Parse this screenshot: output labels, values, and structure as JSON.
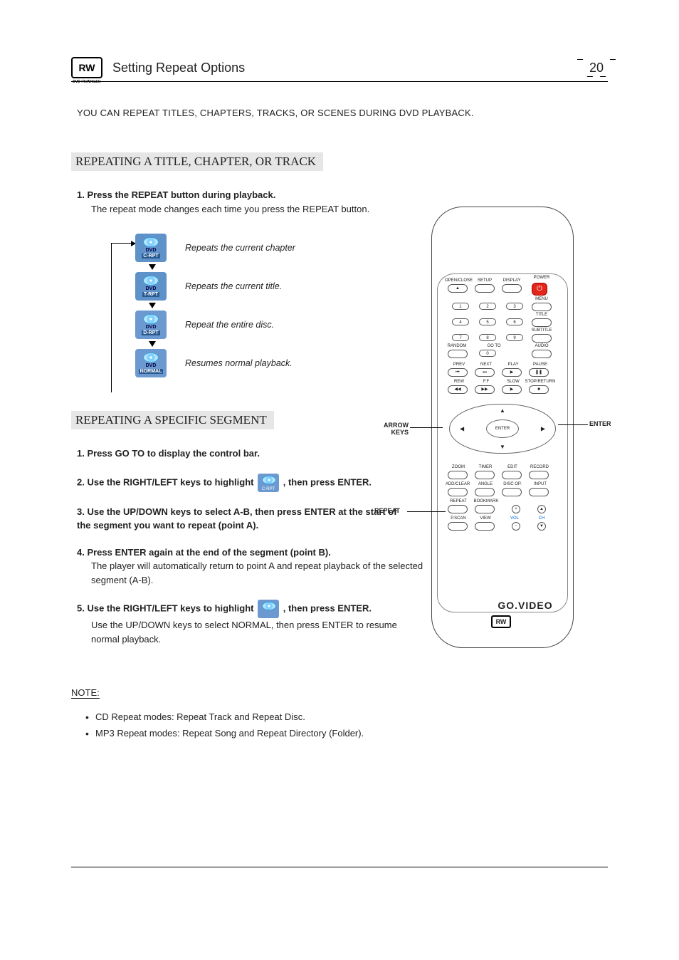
{
  "header": {
    "badge": "RW",
    "badge_sub": "DVD+ReWritable",
    "title": "Setting Repeat Options",
    "page_number": "20"
  },
  "intro": "YOU CAN REPEAT TITLES, CHAPTERS, TRACKS, OR SCENES DURING DVD PLAYBACK.",
  "section1": {
    "heading": "REPEATING A TITLE, CHAPTER, OR TRACK",
    "step1_bold": "1. Press the REPEAT button during playback.",
    "step1_body": "The repeat mode changes each time you press the REPEAT button.",
    "flow": [
      {
        "state": "C-RPT",
        "desc": "Repeats the current chapter"
      },
      {
        "state": "T-RPT",
        "desc": "Repeats the current title."
      },
      {
        "state": "D-RPT",
        "desc": "Repeat the entire disc."
      },
      {
        "state": "NORMAL",
        "desc": "Resumes normal playback."
      }
    ]
  },
  "section2": {
    "heading": "REPEATING A SPECIFIC SEGMENT",
    "s1": "1. Press GO TO to display the control bar.",
    "s2a": "2. Use the  RIGHT/LEFT keys to  highlight",
    "s2_icon_label": "C-RPT",
    "s2b": ", then press ENTER.",
    "s3": "3. Use the UP/DOWN keys to select A-B, then press ENTER at the start of the segment you want to repeat (point  A).",
    "s4_bold": "4. Press ENTER again at the end of the segment (point B).",
    "s4_body": "The player will automatically return to point A and repeat playback of the selected segment (A-B).",
    "s5a": "5. Use the  RIGHT/LEFT keys to  highlight",
    "s5b": ", then press ENTER.",
    "s5_body": "Use the UP/DOWN keys to select NORMAL, then press ENTER to resume normal playback."
  },
  "notes": {
    "heading": "NOTE:",
    "items": [
      "CD Repeat modes: Repeat Track and Repeat Disc.",
      "MP3 Repeat modes: Repeat Song and Repeat Directory (Folder)."
    ]
  },
  "remote": {
    "callouts": {
      "arrow": "ARROW KEYS",
      "enter": "ENTER",
      "repeat": "REPEAT"
    },
    "labels": {
      "openclose": "OPEN/CLOSE",
      "setup": "SETUP",
      "display": "DISPLAY",
      "power": "POWER",
      "menu": "MENU",
      "title": "TITLE",
      "subtitle": "SUBTITLE",
      "audio": "AUDIO",
      "random": "RANDOM",
      "goto": "GO TO",
      "prev": "PREV",
      "next": "NEXT",
      "play": "PLAY",
      "pause": "PAUSE",
      "rew": "REW",
      "ff": "F.F",
      "slow": "SLOW",
      "stopreturn": "STOP/RETURN",
      "zoom": "ZOOM",
      "timer": "TIMER",
      "edit": "EDIT",
      "record": "RECORD",
      "addclear": "ADD/CLEAR",
      "angle": "ANGLE",
      "discop": "DISC OP.",
      "input": "INPUT",
      "repeat": "REPEAT",
      "bookmark": "BOOKMARK",
      "pscan": "P.SCAN",
      "view": "VIEW",
      "vol": "VOL",
      "ch": "CH",
      "enter": "ENTER"
    },
    "numbers": [
      "1",
      "2",
      "3",
      "4",
      "5",
      "6",
      "7",
      "8",
      "9",
      "0"
    ],
    "brand": "GO.VIDEO",
    "brand_badge": "RW"
  }
}
